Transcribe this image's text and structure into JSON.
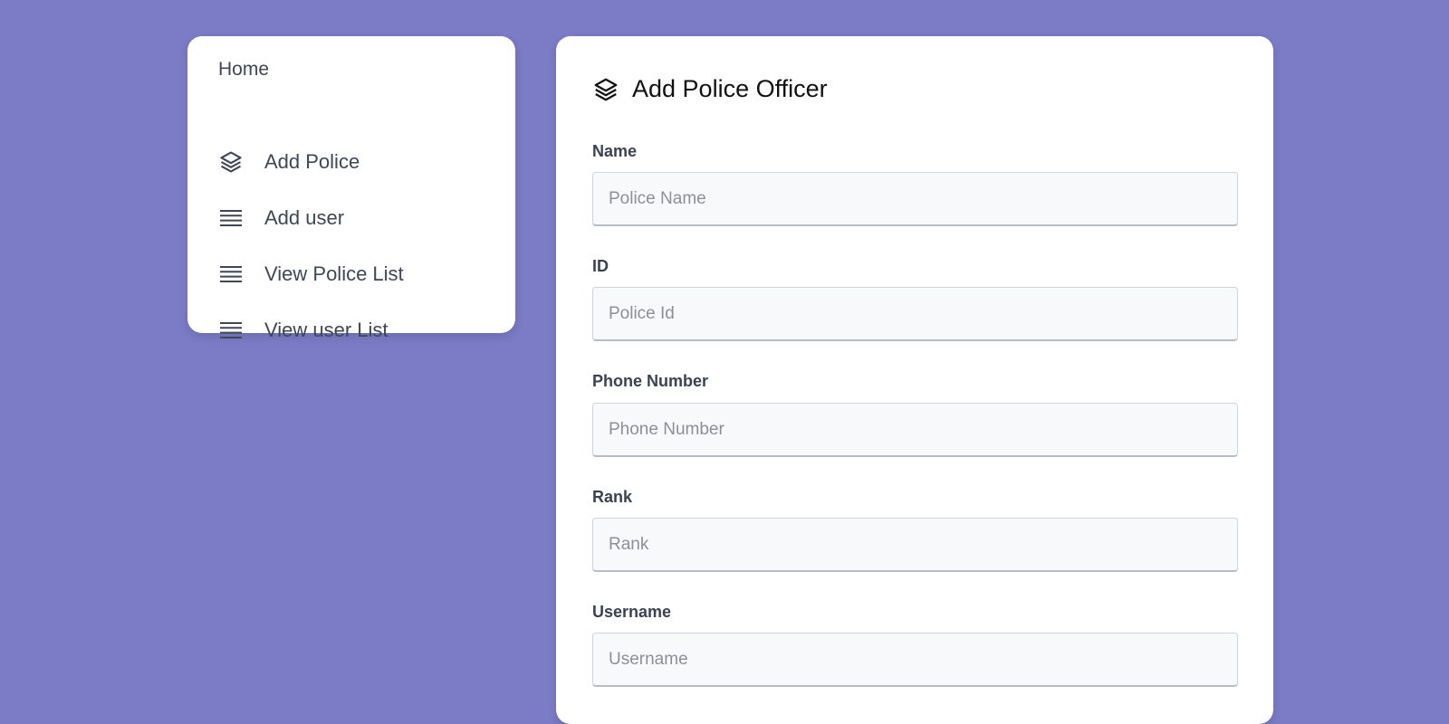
{
  "sidebar": {
    "home_label": "Home",
    "items": [
      {
        "label": "Add Police",
        "icon": "layers-icon"
      },
      {
        "label": "Add user",
        "icon": "menu-lines-icon"
      },
      {
        "label": "View Police List",
        "icon": "menu-lines-icon"
      },
      {
        "label": "View user List",
        "icon": "menu-lines-icon"
      }
    ]
  },
  "form": {
    "title": "Add Police Officer",
    "icon": "layers-icon",
    "fields": [
      {
        "label": "Name",
        "placeholder": "Police Name",
        "value": ""
      },
      {
        "label": "ID",
        "placeholder": "Police Id",
        "value": ""
      },
      {
        "label": "Phone Number",
        "placeholder": "Phone Number",
        "value": ""
      },
      {
        "label": "Rank",
        "placeholder": "Rank",
        "value": ""
      },
      {
        "label": "Username",
        "placeholder": "Username",
        "value": ""
      }
    ]
  },
  "colors": {
    "background": "#7b7bc6",
    "card": "#ffffff",
    "text": "#3f4654"
  }
}
